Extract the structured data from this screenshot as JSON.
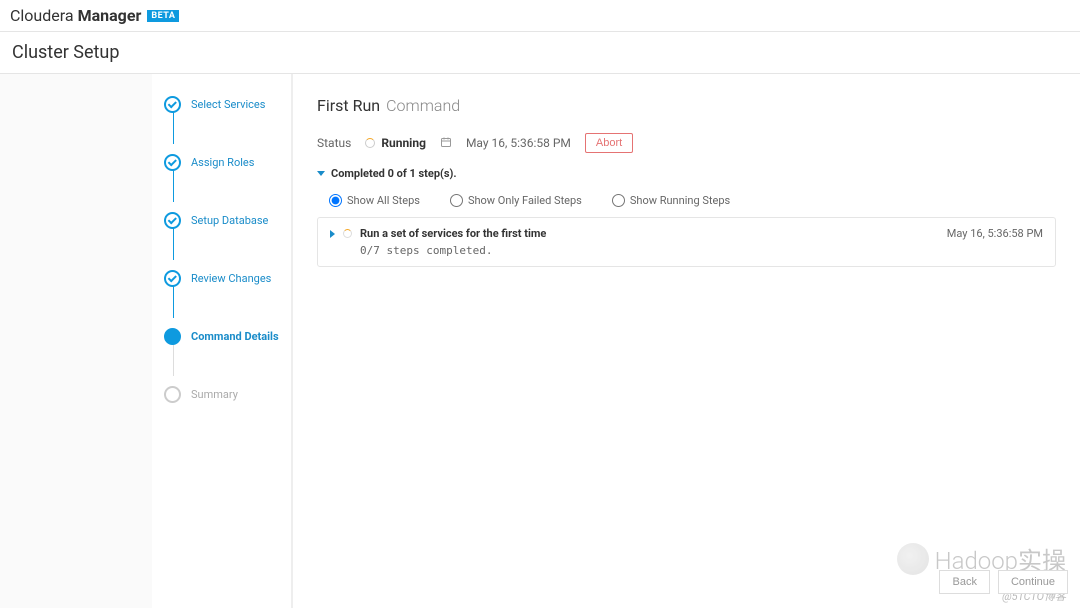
{
  "brand": {
    "cloudera": "Cloudera",
    "manager": "Manager",
    "beta": "BETA"
  },
  "subtitle": "Cluster Setup",
  "steps": [
    {
      "label": "Select Services"
    },
    {
      "label": "Assign Roles"
    },
    {
      "label": "Setup Database"
    },
    {
      "label": "Review Changes"
    },
    {
      "label": "Command Details"
    },
    {
      "label": "Summary"
    }
  ],
  "page": {
    "title_main": "First Run",
    "title_sub": "Command",
    "status_label": "Status",
    "status_value": "Running",
    "timestamp": "May 16, 5:36:58 PM",
    "abort": "Abort",
    "completed_summary": "Completed 0 of 1 step(s).",
    "filters": {
      "all": "Show All Steps",
      "failed": "Show Only Failed Steps",
      "running": "Show Running Steps"
    },
    "task": {
      "title": "Run a set of services for the first time",
      "progress": "0/7 steps completed.",
      "time": "May 16, 5:36:58 PM"
    }
  },
  "nav": {
    "back": "Back",
    "continue": "Continue"
  },
  "watermark": {
    "text": "Hadoop实操",
    "credit": "@51CTO博客"
  }
}
